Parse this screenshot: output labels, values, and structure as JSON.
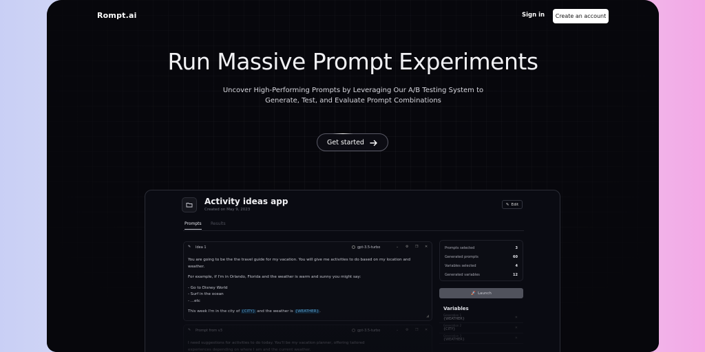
{
  "header": {
    "logo": "Rompt.ai",
    "signin_label": "Sign in",
    "create_account_label": "Create an account"
  },
  "hero": {
    "title": "Run Massive Prompt Experiments",
    "subtitle": "Uncover High-Performing Prompts by Leveraging Our A/B Testing System to Generate, Test, and Evaluate Prompt Combinations",
    "cta_label": "Get started"
  },
  "preview": {
    "app_title": "Activity ideas app",
    "created": "Created on May 9, 2023",
    "edit_label": "Edit",
    "tabs": [
      {
        "label": "Prompts",
        "active": true
      },
      {
        "label": "Results",
        "active": false
      }
    ],
    "cards": [
      {
        "name": "Idea 1",
        "model": "gpt-3.5-turbo",
        "paragraph1": "You are going to be the the travel guide for my vacation. You will give me activities to do based on my location and weather.",
        "paragraph2": "For example, if I'm in Orlando, Florida and the weather is warm and sunny you might say:",
        "list": [
          "- Go to Disney World",
          "- Surf in the ocean",
          "- ...etc"
        ],
        "closing_prefix": "This week I'm in the city of ",
        "var1": "{CITY}",
        "closing_middle": " and the weather is ",
        "var2": "{WEATHER}",
        "closing_suffix": "."
      },
      {
        "name": "Prompt from v3",
        "model": "gpt-3.5-turbo",
        "paragraph1": "I need suggestions for activities to do today. You'll be my vacation planner, offering tailored",
        "paragraph2": "experiences depending on where I am and the current weather."
      }
    ],
    "stats": [
      {
        "label": "Prompts selected",
        "value": "3"
      },
      {
        "label": "Generated prompts",
        "value": "60"
      },
      {
        "label": "Variables selected",
        "value": "4"
      },
      {
        "label": "Generated variables",
        "value": "12"
      }
    ],
    "launch_label": "Launch",
    "variables_title": "Variables",
    "variables": [
      {
        "label": "Generation 1",
        "value": "{WEATHER}"
      },
      {
        "label": "Generation 2",
        "value": "{CITY}"
      },
      {
        "label": "Generation 3",
        "value": "{WEATHER}"
      }
    ]
  }
}
